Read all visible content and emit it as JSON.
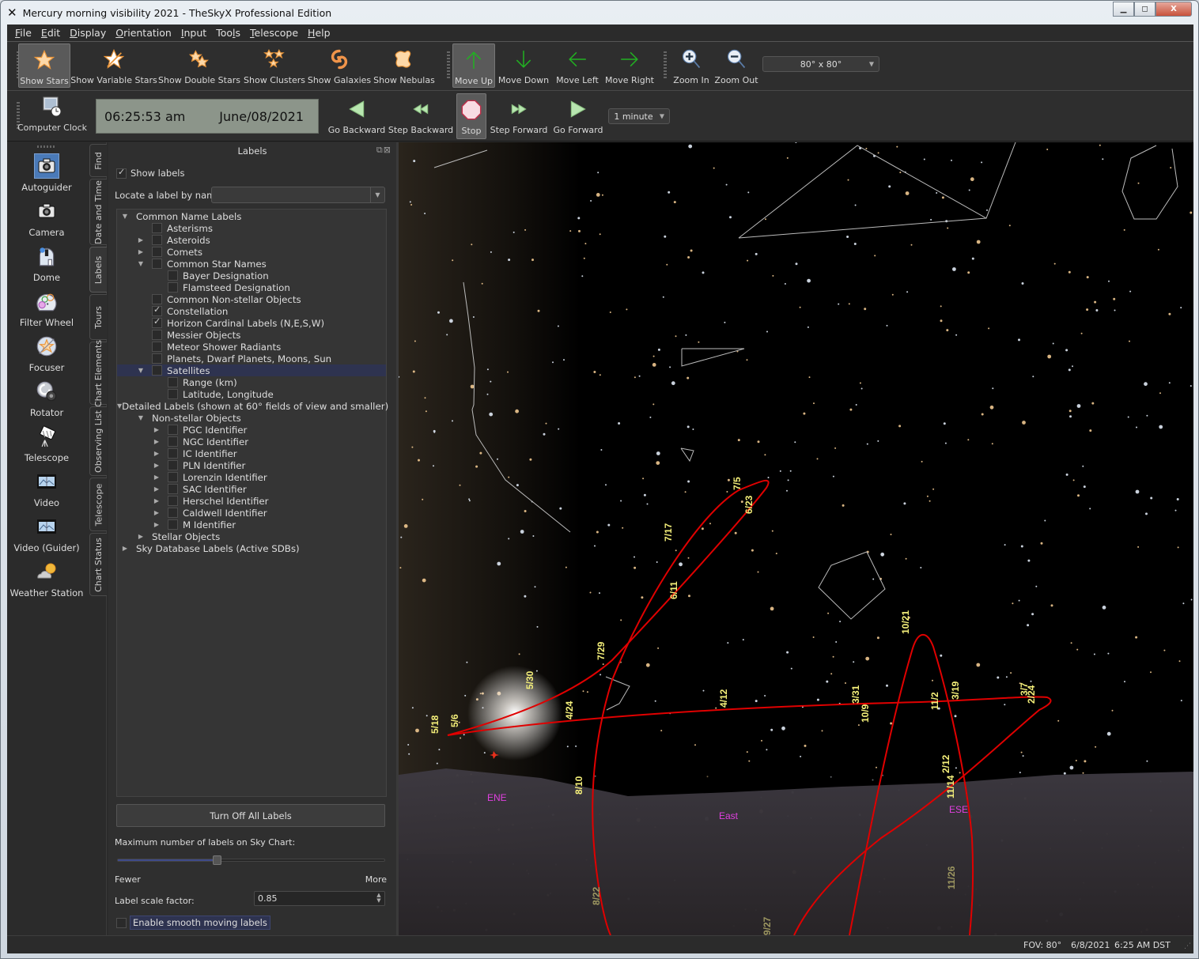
{
  "window": {
    "title": "Mercury morning visibility 2021 - TheSkyX Professional Edition",
    "min_label": "▭",
    "max_label": "⧉",
    "close_label": "X"
  },
  "menu": [
    {
      "label": "File",
      "key": "F"
    },
    {
      "label": "Edit",
      "key": "E"
    },
    {
      "label": "Display",
      "key": "D"
    },
    {
      "label": "Orientation",
      "key": "O"
    },
    {
      "label": "Input",
      "key": "I"
    },
    {
      "label": "Tools",
      "key": "l"
    },
    {
      "label": "Telescope",
      "key": "T"
    },
    {
      "label": "Help",
      "key": "H"
    }
  ],
  "toolbar_objects": [
    {
      "label": "Show Stars",
      "icon": "star-icon",
      "active": true
    },
    {
      "label": "Show Variable Stars",
      "icon": "variable-star-icon"
    },
    {
      "label": "Show Double Stars",
      "icon": "double-star-icon"
    },
    {
      "label": "Show Clusters",
      "icon": "cluster-icon"
    },
    {
      "label": "Show Galaxies",
      "icon": "galaxy-icon"
    },
    {
      "label": "Show Nebulas",
      "icon": "nebula-icon"
    }
  ],
  "toolbar_move": [
    {
      "label": "Move Up",
      "icon": "arrow-up-icon",
      "active": true
    },
    {
      "label": "Move Down",
      "icon": "arrow-down-icon"
    },
    {
      "label": "Move Left",
      "icon": "arrow-left-icon"
    },
    {
      "label": "Move Right",
      "icon": "arrow-right-icon"
    }
  ],
  "toolbar_zoom": [
    {
      "label": "Zoom In",
      "icon": "zoom-in-icon"
    },
    {
      "label": "Zoom Out",
      "icon": "zoom-out-icon"
    }
  ],
  "fov_select": {
    "value": "80° x 80°"
  },
  "time_toolbar": {
    "computer_clock_label": "Computer Clock",
    "time": "06:25:53 am",
    "date": "June/08/2021",
    "buttons": [
      {
        "label": "Go Backward",
        "icon": "go-backward-icon"
      },
      {
        "label": "Step Backward",
        "icon": "step-backward-icon"
      },
      {
        "label": "Stop",
        "icon": "stop-icon",
        "active": true
      },
      {
        "label": "Step Forward",
        "icon": "step-forward-icon"
      },
      {
        "label": "Go Forward",
        "icon": "go-forward-icon"
      }
    ],
    "step_select": "1 minute"
  },
  "left_sidebar": [
    {
      "label": "Autoguider",
      "icon": "autoguider-camera-icon",
      "selected": true
    },
    {
      "label": "Camera",
      "icon": "camera-icon"
    },
    {
      "label": "Dome",
      "icon": "dome-icon"
    },
    {
      "label": "Filter Wheel",
      "icon": "filter-wheel-icon"
    },
    {
      "label": "Focuser",
      "icon": "focuser-icon"
    },
    {
      "label": "Rotator",
      "icon": "rotator-icon"
    },
    {
      "label": "Telescope",
      "icon": "telescope-icon"
    },
    {
      "label": "Video",
      "icon": "video-icon"
    },
    {
      "label": "Video (Guider)",
      "icon": "video-guider-icon"
    },
    {
      "label": "Weather Station",
      "icon": "weather-station-icon"
    }
  ],
  "vertical_tabs": [
    {
      "label": "Find"
    },
    {
      "label": "Date and Time"
    },
    {
      "label": "Labels",
      "selected": true
    },
    {
      "label": "Tours"
    },
    {
      "label": "Chart Elements"
    },
    {
      "label": "Observing List"
    },
    {
      "label": "Telescope"
    },
    {
      "label": "Chart Status"
    }
  ],
  "labels_panel": {
    "title": "Labels",
    "show_labels": {
      "label": "Show labels",
      "checked": true
    },
    "locate_label": "Locate a label by name:",
    "locate_value": "",
    "tree": [
      {
        "label": "Common Name Labels",
        "level": 0,
        "expander": "open",
        "checkbox": false
      },
      {
        "label": "Asterisms",
        "level": 1,
        "expander": "none",
        "checkbox": true,
        "checked": false
      },
      {
        "label": "Asteroids",
        "level": 1,
        "expander": "closed",
        "checkbox": true,
        "checked": false
      },
      {
        "label": "Comets",
        "level": 1,
        "expander": "closed",
        "checkbox": true,
        "checked": false
      },
      {
        "label": "Common Star Names",
        "level": 1,
        "expander": "open",
        "checkbox": true,
        "checked": false
      },
      {
        "label": "Bayer Designation",
        "level": 2,
        "expander": "none",
        "checkbox": true,
        "checked": false
      },
      {
        "label": "Flamsteed Designation",
        "level": 2,
        "expander": "none",
        "checkbox": true,
        "checked": false
      },
      {
        "label": "Common Non-stellar Objects",
        "level": 1,
        "expander": "none",
        "checkbox": true,
        "checked": false
      },
      {
        "label": "Constellation",
        "level": 1,
        "expander": "none",
        "checkbox": true,
        "checked": true
      },
      {
        "label": "Horizon Cardinal Labels (N,E,S,W)",
        "level": 1,
        "expander": "none",
        "checkbox": true,
        "checked": true
      },
      {
        "label": "Messier Objects",
        "level": 1,
        "expander": "none",
        "checkbox": true,
        "checked": false
      },
      {
        "label": "Meteor Shower Radiants",
        "level": 1,
        "expander": "none",
        "checkbox": true,
        "checked": false
      },
      {
        "label": "Planets, Dwarf Planets, Moons, Sun",
        "level": 1,
        "expander": "none",
        "checkbox": true,
        "checked": false
      },
      {
        "label": "Satellites",
        "level": 1,
        "expander": "open",
        "checkbox": true,
        "checked": false,
        "selected": true
      },
      {
        "label": "Range (km)",
        "level": 2,
        "expander": "none",
        "checkbox": true,
        "checked": false
      },
      {
        "label": "Latitude, Longitude",
        "level": 2,
        "expander": "none",
        "checkbox": true,
        "checked": false
      },
      {
        "label": "Detailed Labels (shown at 60° fields of view and smaller)",
        "level": 0,
        "expander": "open",
        "checkbox": false
      },
      {
        "label": "Non-stellar Objects",
        "level": 1,
        "expander": "open",
        "checkbox": false
      },
      {
        "label": "PGC Identifier",
        "level": 2,
        "expander": "closed",
        "checkbox": true,
        "checked": false
      },
      {
        "label": "NGC Identifier",
        "level": 2,
        "expander": "closed",
        "checkbox": true,
        "checked": false
      },
      {
        "label": "IC Identifier",
        "level": 2,
        "expander": "closed",
        "checkbox": true,
        "checked": false
      },
      {
        "label": "PLN Identifier",
        "level": 2,
        "expander": "closed",
        "checkbox": true,
        "checked": false
      },
      {
        "label": "Lorenzin Identifier",
        "level": 2,
        "expander": "closed",
        "checkbox": true,
        "checked": false
      },
      {
        "label": "SAC Identifier",
        "level": 2,
        "expander": "closed",
        "checkbox": true,
        "checked": false
      },
      {
        "label": "Herschel Identifier",
        "level": 2,
        "expander": "closed",
        "checkbox": true,
        "checked": false
      },
      {
        "label": "Caldwell Identifier",
        "level": 2,
        "expander": "closed",
        "checkbox": true,
        "checked": false
      },
      {
        "label": "M Identifier",
        "level": 2,
        "expander": "closed",
        "checkbox": true,
        "checked": false
      },
      {
        "label": "Stellar Objects",
        "level": 1,
        "expander": "closed",
        "checkbox": false
      },
      {
        "label": "Sky Database Labels (Active SDBs)",
        "level": 0,
        "expander": "closed",
        "checkbox": false
      }
    ],
    "turn_off_button": "Turn Off All Labels",
    "max_labels_label": "Maximum number of labels on Sky Chart:",
    "max_labels_slider_fraction": 0.37,
    "fewer_label": "Fewer",
    "more_label": "More",
    "scale_label": "Label scale factor:",
    "scale_value": "0.85",
    "smooth_labels": {
      "label": "Enable smooth moving labels",
      "checked": false
    }
  },
  "sky_chart": {
    "horizon_labels": [
      "ENE",
      "East",
      "ESE"
    ],
    "mercury_path_dates": [
      "5/18",
      "5/6",
      "5/30",
      "4/24",
      "7/29",
      "6/11",
      "7/17",
      "7/5",
      "6/23",
      "4/12",
      "3/31",
      "10/9",
      "10/21",
      "11/2",
      "3/19",
      "3/7",
      "2/24",
      "2/12",
      "11/14",
      "8/10",
      "8/22",
      "9/27",
      "11/26"
    ],
    "path_color": "#e00000",
    "label_color": "#f5f07a",
    "horizon_label_color": "#e040e0"
  },
  "status_bar": {
    "fov": "FOV: 80°",
    "date": "6/8/2021",
    "time": "6:25 AM DST"
  }
}
